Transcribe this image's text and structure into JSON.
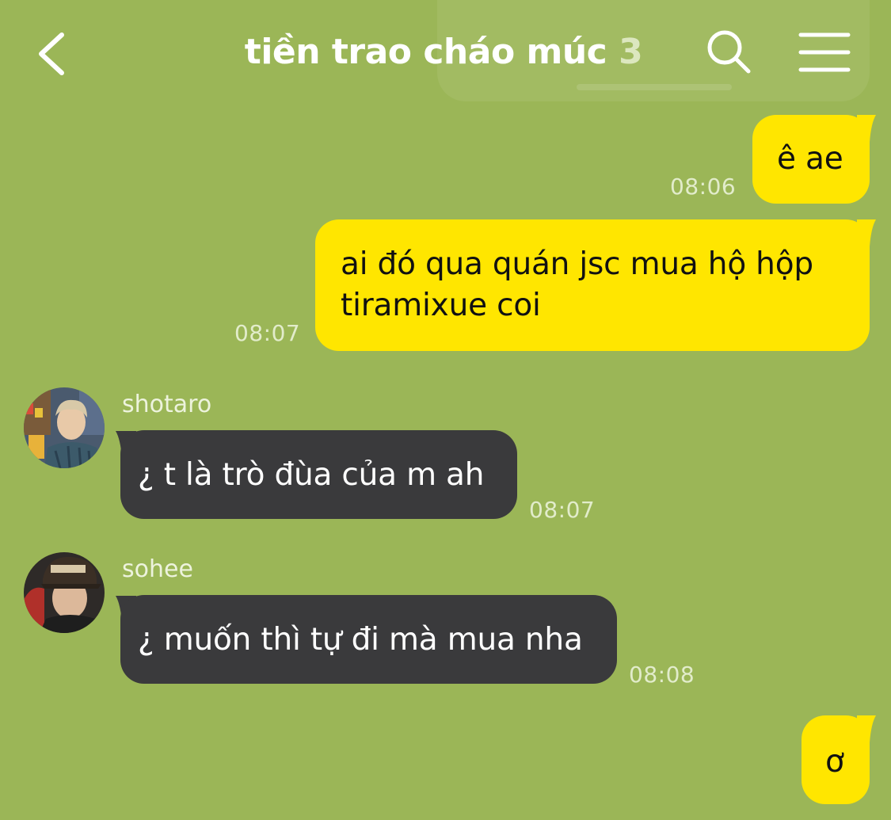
{
  "header": {
    "title": "tiền trao cháo múc",
    "member_count": "3",
    "back_icon": "chevron-left-icon",
    "search_icon": "search-icon",
    "menu_icon": "hamburger-menu-icon"
  },
  "colors": {
    "background": "#9bb657",
    "my_bubble": "#ffe600",
    "their_bubble": "#3a3a3c"
  },
  "messages": [
    {
      "from": "me",
      "text": "ê ae",
      "time": "08:06"
    },
    {
      "from": "me",
      "line1": "ai đó qua quán jsc mua hộ hộp",
      "line2": "tiramixue coi",
      "time": "08:07"
    },
    {
      "sender": "shotaro",
      "text": "¿ t là trò đùa của m ah",
      "time": "08:07"
    },
    {
      "sender": "sohee",
      "text": "¿ muốn thì tự đi mà mua nha",
      "time": "08:08"
    },
    {
      "from": "me",
      "text": "ơ"
    }
  ]
}
